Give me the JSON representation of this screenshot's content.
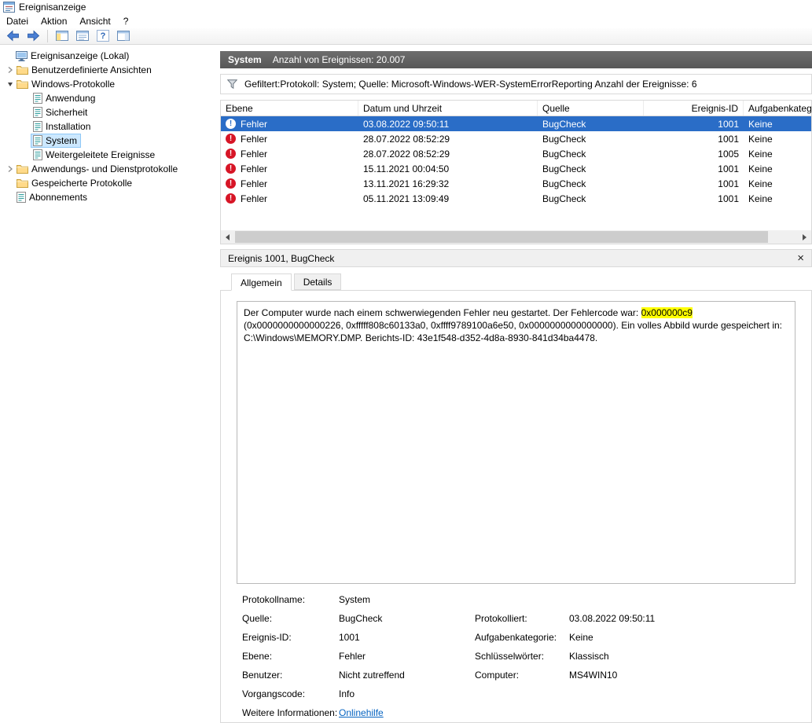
{
  "titlebar": {
    "title": "Ereignisanzeige"
  },
  "menubar": {
    "items": [
      "Datei",
      "Aktion",
      "Ansicht",
      "?"
    ]
  },
  "tree": {
    "items": [
      {
        "label": "Ereignisanzeige (Lokal)"
      },
      {
        "label": "Benutzerdefinierte Ansichten"
      },
      {
        "label": "Windows-Protokolle"
      },
      {
        "label": "Anwendung"
      },
      {
        "label": "Sicherheit"
      },
      {
        "label": "Installation"
      },
      {
        "label": "System"
      },
      {
        "label": "Weitergeleitete Ereignisse"
      },
      {
        "label": "Anwendungs- und Dienstprotokolle"
      },
      {
        "label": "Gespeicherte Protokolle"
      },
      {
        "label": "Abonnements"
      }
    ]
  },
  "results": {
    "log_name": "System",
    "event_count_label": "Anzahl von Ereignissen: 20.007",
    "filter_text": "Gefiltert:Protokoll: System; Quelle: Microsoft-Windows-WER-SystemErrorReporting Anzahl der Ereignisse: 6"
  },
  "table": {
    "columns": [
      "Ebene",
      "Datum und Uhrzeit",
      "Quelle",
      "Ereignis-ID",
      "Aufgabenkategorie"
    ],
    "rows": [
      {
        "level": "Fehler",
        "datetime": "03.08.2022 09:50:11",
        "source": "BugCheck",
        "event_id": "1001",
        "task_category": "Keine"
      },
      {
        "level": "Fehler",
        "datetime": "28.07.2022 08:52:29",
        "source": "BugCheck",
        "event_id": "1001",
        "task_category": "Keine"
      },
      {
        "level": "Fehler",
        "datetime": "28.07.2022 08:52:29",
        "source": "BugCheck",
        "event_id": "1005",
        "task_category": "Keine"
      },
      {
        "level": "Fehler",
        "datetime": "15.11.2021 00:04:50",
        "source": "BugCheck",
        "event_id": "1001",
        "task_category": "Keine"
      },
      {
        "level": "Fehler",
        "datetime": "13.11.2021 16:29:32",
        "source": "BugCheck",
        "event_id": "1001",
        "task_category": "Keine"
      },
      {
        "level": "Fehler",
        "datetime": "05.11.2021 13:09:49",
        "source": "BugCheck",
        "event_id": "1001",
        "task_category": "Keine"
      }
    ]
  },
  "detail": {
    "header": "Ereignis 1001, BugCheck",
    "tabs": [
      "Allgemein",
      "Details"
    ],
    "description": {
      "before": "Der Computer wurde nach einem schwerwiegenden Fehler neu gestartet. Der Fehlercode war: ",
      "highlight": "0x000000c9",
      "after": " (0x0000000000000226, 0xfffff808c60133a0, 0xffff9789100a6e50, 0x0000000000000000). Ein volles Abbild wurde gespeichert in: C:\\Windows\\MEMORY.DMP. Berichts-ID: 43e1f548-d352-4d8a-8930-841d34ba4478."
    },
    "properties": [
      {
        "label": "Protokollname:",
        "value": "System",
        "label2": "",
        "value2": ""
      },
      {
        "label": "Quelle:",
        "value": "BugCheck",
        "label2": "Protokolliert:",
        "value2": "03.08.2022 09:50:11"
      },
      {
        "label": "Ereignis-ID:",
        "value": "1001",
        "label2": "Aufgabenkategorie:",
        "value2": "Keine"
      },
      {
        "label": "Ebene:",
        "value": "Fehler",
        "label2": "Schlüsselwörter:",
        "value2": "Klassisch"
      },
      {
        "label": "Benutzer:",
        "value": "Nicht zutreffend",
        "label2": "Computer:",
        "value2": "MS4WIN10"
      },
      {
        "label": "Vorgangscode:",
        "value": "Info",
        "label2": "",
        "value2": ""
      },
      {
        "label": "Weitere Informationen:",
        "value": "Onlinehilfe",
        "label2": "",
        "value2": ""
      }
    ]
  },
  "colors": {
    "selection_blue": "#2a6dc7",
    "search_highlight": "#ffff00",
    "error_red": "#d71526",
    "link_blue": "#0563c1",
    "results_header_gray": "#5f5f5f",
    "tree_selection": "#cce8ff"
  }
}
